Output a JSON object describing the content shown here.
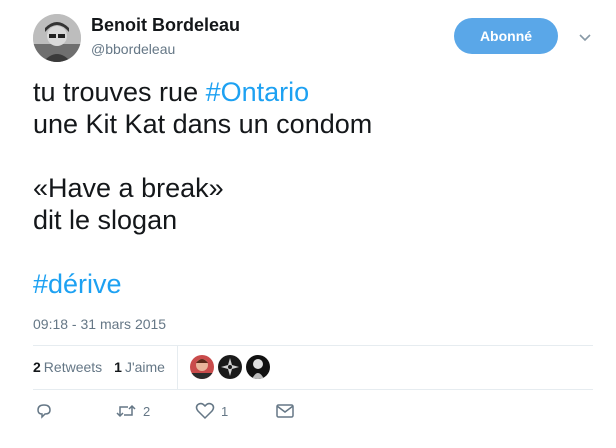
{
  "author": {
    "name": "Benoit Bordeleau",
    "handle": "@bbordeleau",
    "avatar_icon": "user-avatar-photo"
  },
  "follow_button": {
    "label": "Abonné",
    "color": "#5aa7e8"
  },
  "menu_icon": "chevron-down-icon",
  "tweet": {
    "line1_prefix": "tu trouves rue ",
    "line1_hashtag": "#Ontario",
    "line2": "une Kit Kat dans un condom",
    "line3": "«Have a break»",
    "line4": "dit le slogan",
    "hashtag2": "#dérive",
    "hashtag_color": "#1da1f2"
  },
  "timestamp": "09:18 - 31 mars 2015",
  "stats": {
    "retweets_count": "2",
    "retweets_label": "Retweets",
    "likes_count": "1",
    "likes_label": "J'aime"
  },
  "liker_avatars": [
    "liker-avatar-1",
    "liker-avatar-2",
    "liker-avatar-3"
  ],
  "actions": {
    "reply_icon": "reply-icon",
    "retweet_icon": "retweet-icon",
    "retweet_count": "2",
    "like_icon": "heart-icon",
    "like_count": "1",
    "message_icon": "envelope-icon"
  }
}
